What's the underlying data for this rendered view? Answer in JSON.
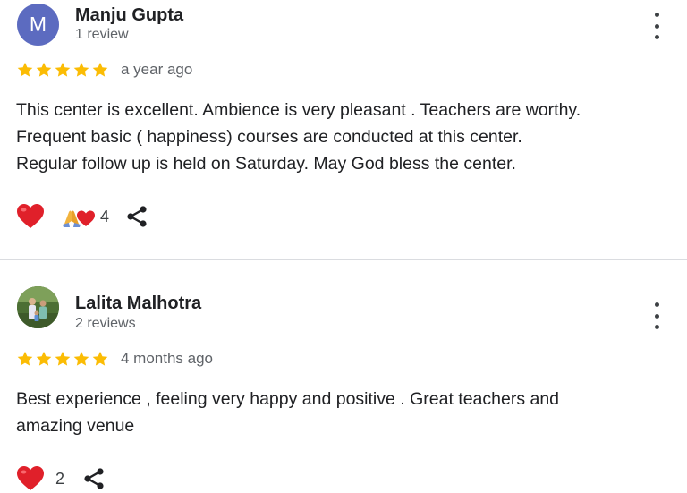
{
  "reviews": [
    {
      "avatar_letter": "M",
      "avatar_color": "#5c6bc0",
      "name": "Manju Gupta",
      "review_count": "1 review",
      "rating": 5,
      "time": "a year ago",
      "text_lines": [
        "This center is excellent. Ambience is very pleasant . Teachers are worthy.",
        "Frequent basic ( happiness) courses are conducted at this center.",
        "Regular follow up is held on Saturday. May God bless the center."
      ],
      "reaction_count": "4"
    },
    {
      "name": "Lalita Malhotra",
      "review_count": "2 reviews",
      "rating": 5,
      "time": "4 months ago",
      "text_lines": [
        "Best experience , feeling very happy and positive . Great teachers and",
        "amazing venue"
      ],
      "reaction_count": "2"
    }
  ],
  "colors": {
    "star": "#fbbc04",
    "heart": "#e0202a",
    "divider": "#dadce0"
  },
  "icons": {
    "more": "more-vert-icon",
    "heart": "heart-icon",
    "pray_heart": "praying-hands-heart-icon",
    "share": "share-icon",
    "star": "star-icon"
  }
}
